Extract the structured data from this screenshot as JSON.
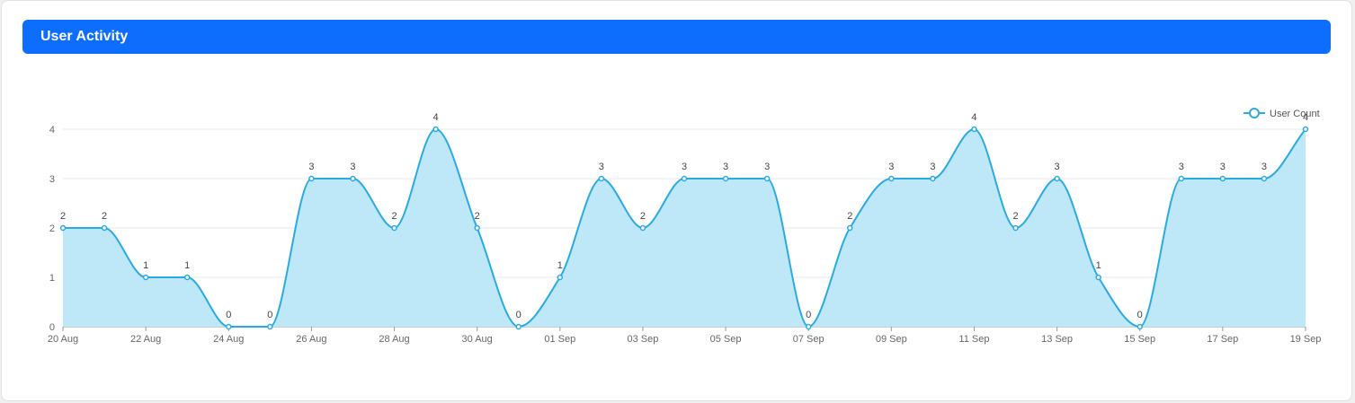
{
  "card": {
    "title": "User Activity",
    "header_color": "#0d6efd"
  },
  "chart_data": {
    "type": "area",
    "title": "",
    "xlabel": "",
    "ylabel": "",
    "x": [
      "20 Aug",
      "21 Aug",
      "22 Aug",
      "23 Aug",
      "24 Aug",
      "25 Aug",
      "26 Aug",
      "27 Aug",
      "28 Aug",
      "29 Aug",
      "30 Aug",
      "31 Aug",
      "01 Sep",
      "02 Sep",
      "03 Sep",
      "04 Sep",
      "05 Sep",
      "06 Sep",
      "07 Sep",
      "08 Sep",
      "09 Sep",
      "10 Sep",
      "11 Sep",
      "12 Sep",
      "13 Sep",
      "14 Sep",
      "15 Sep",
      "16 Sep",
      "17 Sep",
      "18 Sep",
      "19 Sep"
    ],
    "x_tick_labels": [
      "20 Aug",
      "22 Aug",
      "24 Aug",
      "26 Aug",
      "28 Aug",
      "30 Aug",
      "01 Sep",
      "03 Sep",
      "05 Sep",
      "07 Sep",
      "09 Sep",
      "11 Sep",
      "13 Sep",
      "15 Sep",
      "17 Sep",
      "19 Sep"
    ],
    "y_ticks": [
      0,
      1,
      2,
      3,
      4
    ],
    "ylim": [
      0,
      4
    ],
    "series": [
      {
        "name": "User Count",
        "values": [
          2,
          2,
          1,
          1,
          0,
          0,
          3,
          3,
          2,
          4,
          2,
          0,
          1,
          3,
          2,
          3,
          3,
          3,
          0,
          2,
          3,
          3,
          4,
          2,
          3,
          1,
          0,
          3,
          3,
          3,
          4
        ]
      }
    ],
    "smooth": true,
    "data_labels": true,
    "grid": "horizontal",
    "legend_position": "top-right",
    "colors": {
      "line": "#29abe2",
      "fill": "#bee7f8",
      "grid": "#e4e7ef"
    }
  }
}
